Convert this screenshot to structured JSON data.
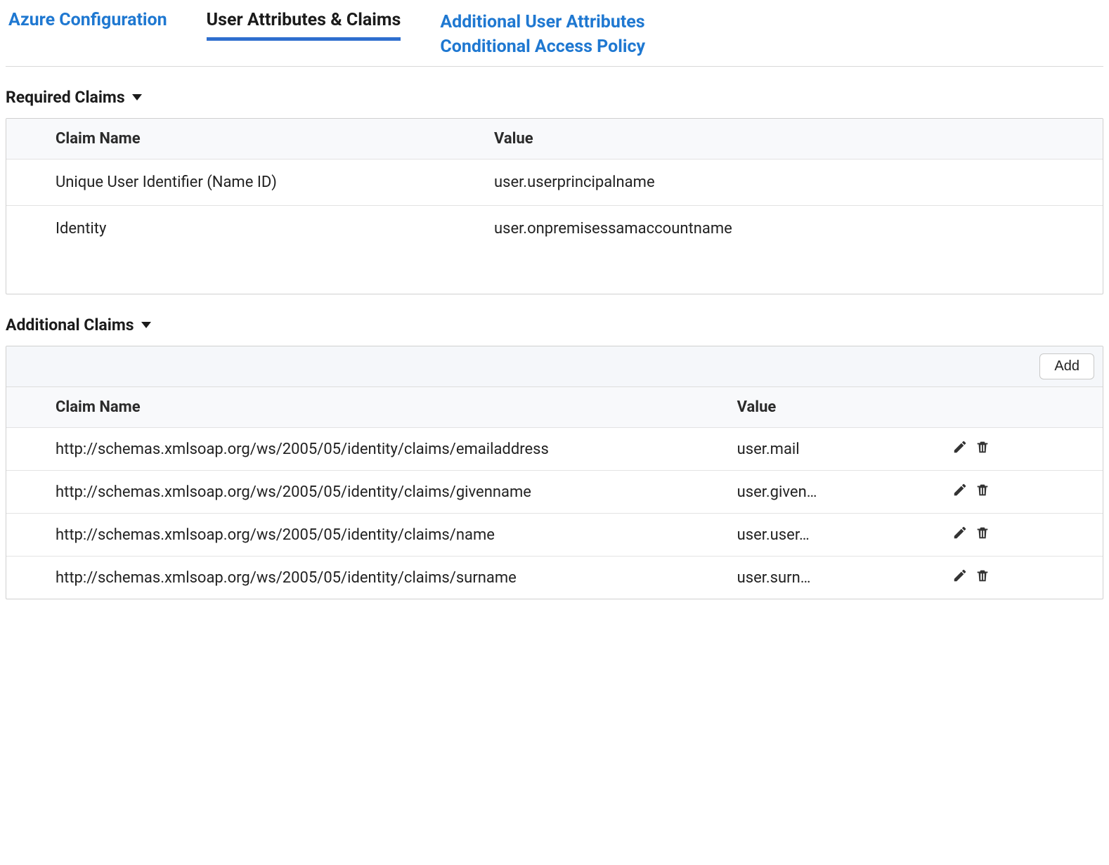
{
  "tabs": [
    {
      "label": "Azure Configuration",
      "active": false
    },
    {
      "label": "User Attributes & Claims",
      "active": true
    },
    {
      "label": "Additional User Attributes Conditional Access Policy",
      "active": false
    }
  ],
  "required": {
    "title": "Required Claims",
    "columns": {
      "name": "Claim Name",
      "value": "Value"
    },
    "rows": [
      {
        "name": "Unique User Identifier (Name ID)",
        "value": "user.userprincipalname"
      },
      {
        "name": "Identity",
        "value": "user.onpremisessamaccountname"
      }
    ]
  },
  "additional": {
    "title": "Additional Claims",
    "add_label": "Add",
    "columns": {
      "name": "Claim Name",
      "value": "Value"
    },
    "rows": [
      {
        "name": "http://schemas.xmlsoap.org/ws/2005/05/identity/claims/emailaddress",
        "value": "user.mail"
      },
      {
        "name": "http://schemas.xmlsoap.org/ws/2005/05/identity/claims/givenname",
        "value": "user.given…"
      },
      {
        "name": "http://schemas.xmlsoap.org/ws/2005/05/identity/claims/name",
        "value": "user.user…"
      },
      {
        "name": "http://schemas.xmlsoap.org/ws/2005/05/identity/claims/surname",
        "value": "user.surn…"
      }
    ]
  }
}
